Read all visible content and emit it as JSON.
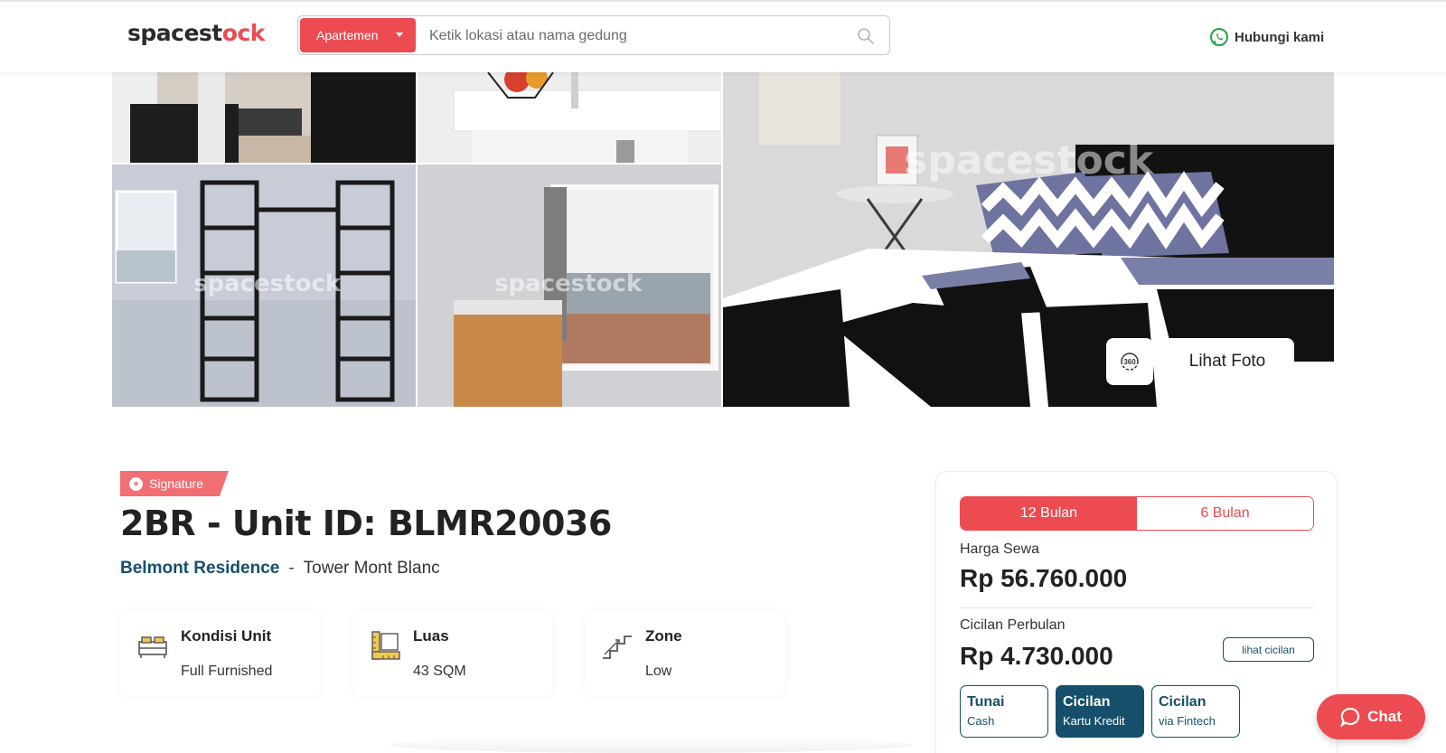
{
  "header": {
    "logo_main": "spacest",
    "logo_accent": "ock",
    "search_type": "Apartemen",
    "search_placeholder": "Ketik lokasi atau nama gedung",
    "contact_label": "Hubungi kami"
  },
  "gallery": {
    "watermark": "spacestock",
    "btn_360": "360",
    "view_photos": "Lihat Foto"
  },
  "unit": {
    "badge": "Signature",
    "title": "2BR - Unit ID: BLMR20036",
    "building": "Belmont Residence",
    "separator": "-",
    "tower": "Tower Mont Blanc",
    "specs": [
      {
        "title": "Kondisi Unit",
        "value": "Full Furnished",
        "icon": "bed-icon"
      },
      {
        "title": "Luas",
        "value": "43 SQM",
        "icon": "ruler-icon"
      },
      {
        "title": "Zone",
        "value": "Low",
        "icon": "stairs-icon"
      }
    ]
  },
  "price_card": {
    "periods": [
      "12 Bulan",
      "6 Bulan"
    ],
    "rent_label": "Harga Sewa",
    "rent_value": "Rp 56.760.000",
    "installment_label": "Cicilan Perbulan",
    "installment_value": "Rp 4.730.000",
    "installment_link": "lihat cicilan",
    "payment_options": [
      {
        "title": "Tunai",
        "sub": "Cash"
      },
      {
        "title": "Cicilan",
        "sub": "Kartu Kredit"
      },
      {
        "title": "Cicilan",
        "sub": "via Fintech"
      }
    ]
  },
  "chat": {
    "label": "Chat"
  },
  "colors": {
    "brand_red": "#ec4b52",
    "brand_navy": "#154f6b"
  }
}
